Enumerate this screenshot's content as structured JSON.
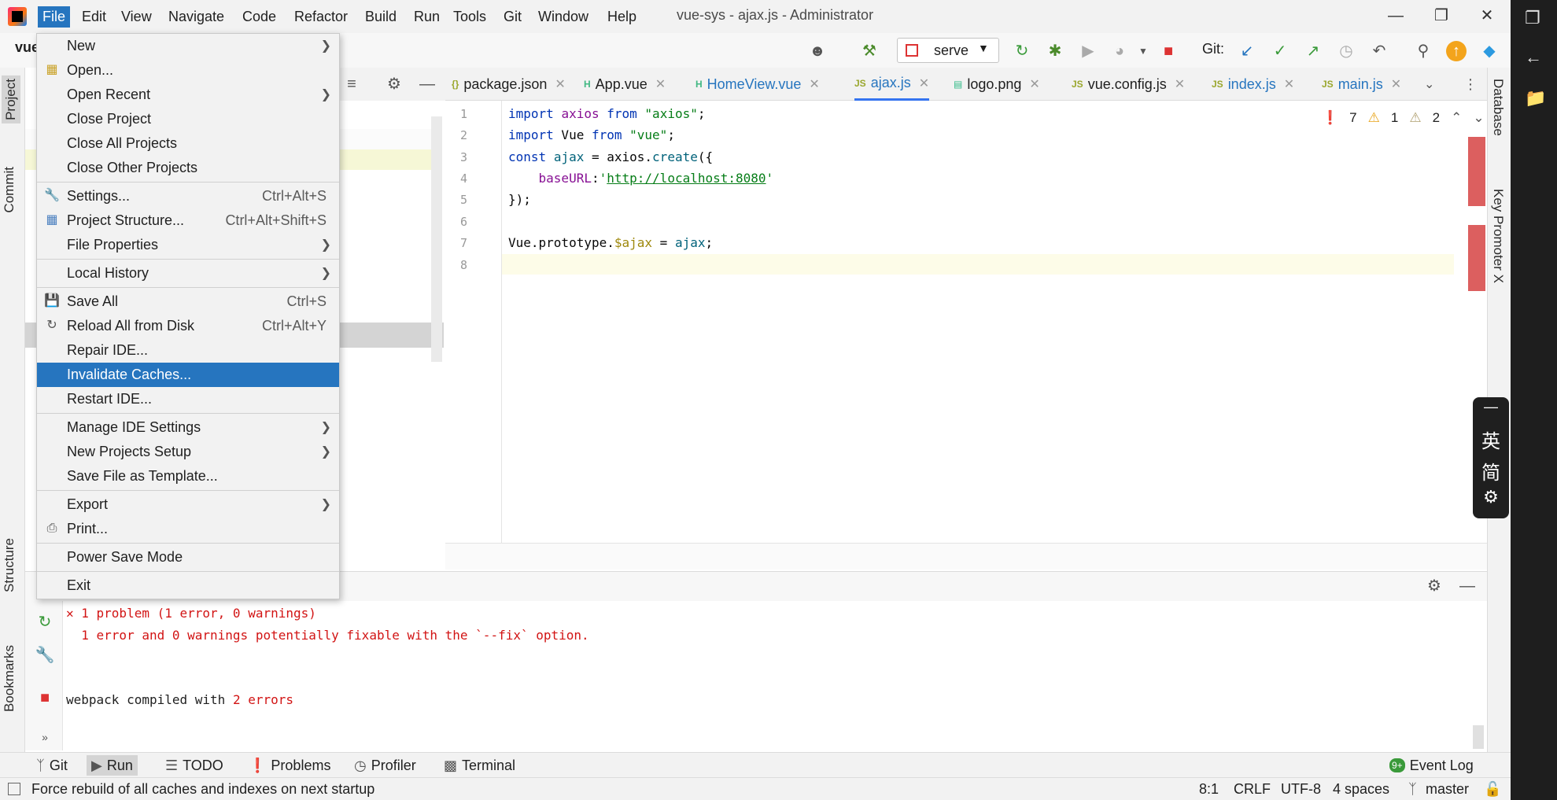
{
  "menubar": {
    "items": [
      "File",
      "Edit",
      "View",
      "Navigate",
      "Code",
      "Refactor",
      "Build",
      "Run",
      "Tools",
      "Git",
      "Window",
      "Help"
    ],
    "window_title": "vue-sys - ajax.js - Administrator"
  },
  "project": {
    "name": "vue"
  },
  "toolbar": {
    "run_config": "serve",
    "git_label": "Git:"
  },
  "tabs": [
    {
      "label": "package.json",
      "icon": "json-file-icon"
    },
    {
      "label": "App.vue",
      "icon": "vue-file-icon"
    },
    {
      "label": "HomeView.vue",
      "icon": "vue-file-icon"
    },
    {
      "label": "ajax.js",
      "icon": "js-file-icon",
      "active": true
    },
    {
      "label": "logo.png",
      "icon": "image-file-icon"
    },
    {
      "label": "vue.config.js",
      "icon": "js-file-icon"
    },
    {
      "label": "index.js",
      "icon": "js-file-icon"
    },
    {
      "label": "main.js",
      "icon": "js-file-icon"
    }
  ],
  "editor": {
    "line_numbers": [
      "1",
      "2",
      "3",
      "4",
      "5",
      "6",
      "7",
      "8"
    ],
    "inspections": {
      "errors": "7",
      "warnings": "1",
      "weak_warnings": "2"
    }
  },
  "file_menu": {
    "items": [
      {
        "label": "New",
        "submenu": true
      },
      {
        "label": "Open...",
        "icon": "folder-icon"
      },
      {
        "label": "Open Recent",
        "submenu": true
      },
      {
        "label": "Close Project"
      },
      {
        "label": "Close All Projects"
      },
      {
        "label": "Close Other Projects"
      },
      {
        "label": "Settings...",
        "shortcut": "Ctrl+Alt+S",
        "icon": "wrench-icon"
      },
      {
        "label": "Project Structure...",
        "shortcut": "Ctrl+Alt+Shift+S",
        "icon": "project-structure-icon"
      },
      {
        "label": "File Properties",
        "submenu": true
      },
      {
        "label": "Local History",
        "submenu": true
      },
      {
        "label": "Save All",
        "shortcut": "Ctrl+S",
        "icon": "save-icon"
      },
      {
        "label": "Reload All from Disk",
        "shortcut": "Ctrl+Alt+Y",
        "icon": "reload-icon"
      },
      {
        "label": "Repair IDE..."
      },
      {
        "label": "Invalidate Caches...",
        "selected": true
      },
      {
        "label": "Restart IDE..."
      },
      {
        "label": "Manage IDE Settings",
        "submenu": true
      },
      {
        "label": "New Projects Setup",
        "submenu": true
      },
      {
        "label": "Save File as Template..."
      },
      {
        "label": "Export",
        "submenu": true
      },
      {
        "label": "Print...",
        "icon": "print-icon"
      },
      {
        "label": "Power Save Mode"
      },
      {
        "label": "Exit"
      }
    ]
  },
  "side_tabs": {
    "left": [
      "Project",
      "Commit",
      "Structure",
      "Bookmarks"
    ],
    "right": [
      "Database",
      "Key Promoter X"
    ]
  },
  "ime": [
    "英",
    "简"
  ],
  "run_output": {
    "problem_line": "1 problem (1 error, 0 warnings)",
    "fix_line": "1 error and 0 warnings potentially fixable with the `--fix` option.",
    "webpack_prefix": "webpack compiled with",
    "webpack_errors": "2 errors"
  },
  "bottom_tools": [
    "Git",
    "Run",
    "TODO",
    "Problems",
    "Profiler",
    "Terminal"
  ],
  "event_log": "Event Log",
  "event_log_badge": "9+",
  "statusbar": {
    "message": "Force rebuild of all caches and indexes on next startup",
    "position": "8:1",
    "line_sep": "CRLF",
    "encoding": "UTF-8",
    "indent": "4 spaces",
    "branch": "master"
  },
  "colors": {
    "accent": "#2675bf",
    "error": "#d21414",
    "string": "#067d17",
    "keyword": "#0033b3"
  }
}
